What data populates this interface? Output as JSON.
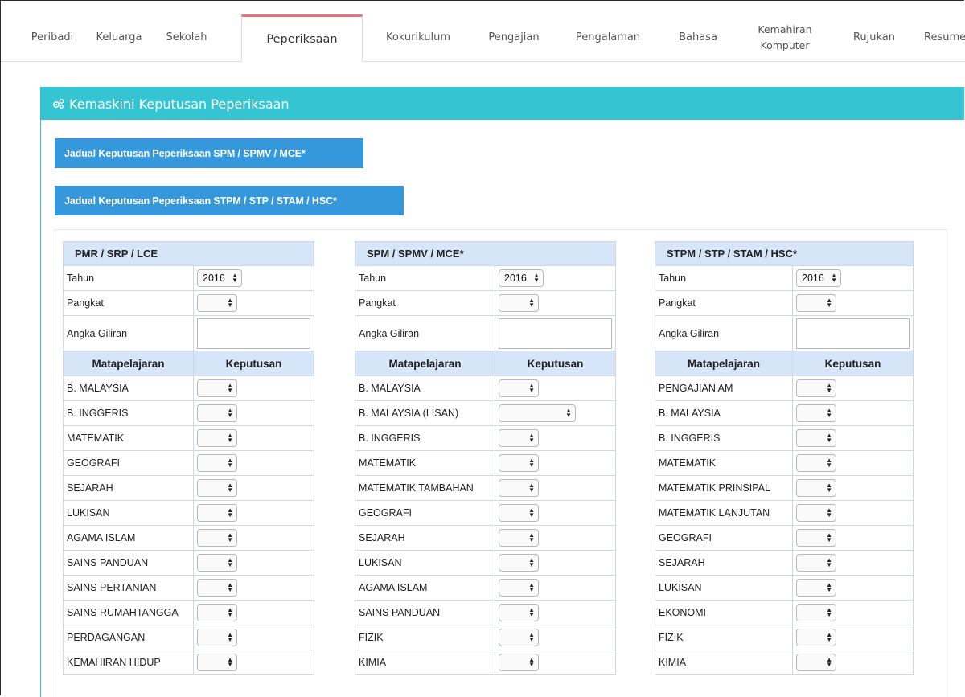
{
  "tabs": [
    {
      "label": "Peribadi"
    },
    {
      "label": "Keluarga"
    },
    {
      "label": "Sekolah"
    },
    {
      "label": "Peperiksaan"
    },
    {
      "label": "Kokurikulum"
    },
    {
      "label": "Pengajian"
    },
    {
      "label": "Pengalaman"
    },
    {
      "label": "Bahasa"
    },
    {
      "label": "Kemahiran Komputer"
    },
    {
      "label": "Rujukan"
    },
    {
      "label": "Resume"
    }
  ],
  "active_tab": "Peperiksaan",
  "panel": {
    "title": "Kemaskini Keputusan Peperiksaan",
    "icon": "cogs-icon",
    "header_color": "#34c4d2"
  },
  "buttons": {
    "spm_schedule": "Jadual Keputusan Peperiksaan SPM / SPMV / MCE*",
    "stpm_schedule": "Jadual Keputusan Peperiksaan STPM / STP / STAM / HSC*",
    "color": "#3598dc"
  },
  "labels": {
    "tahun": "Tahun",
    "pangkat": "Pangkat",
    "angka_giliran": "Angka Giliran",
    "matapelajaran": "Matapelajaran",
    "keputusan": "Keputusan"
  },
  "sections": [
    {
      "title": "PMR / SRP / LCE",
      "tahun": "2016",
      "pangkat": "",
      "angka_giliran": "",
      "subjects": [
        "B. MALAYSIA",
        "B. INGGERIS",
        "MATEMATIK",
        "GEOGRAFI",
        "SEJARAH",
        "LUKISAN",
        "AGAMA ISLAM",
        "SAINS PANDUAN",
        "SAINS PERTANIAN",
        "SAINS RUMAHTANGGA",
        "PERDAGANGAN",
        "KEMAHIRAN HIDUP"
      ]
    },
    {
      "title": "SPM / SPMV / MCE*",
      "tahun": "2016",
      "pangkat": "",
      "angka_giliran": "",
      "subjects": [
        "B. MALAYSIA",
        "B. MALAYSIA (LISAN)",
        "B. INGGERIS",
        "MATEMATIK",
        "MATEMATIK TAMBAHAN",
        "GEOGRAFI",
        "SEJARAH",
        "LUKISAN",
        "AGAMA ISLAM",
        "SAINS PANDUAN",
        "FIZIK",
        "KIMIA"
      ]
    },
    {
      "title": "STPM / STP / STAM / HSC*",
      "tahun": "2016",
      "pangkat": "",
      "angka_giliran": "",
      "subjects": [
        "PENGAJIAN AM",
        "B. MALAYSIA",
        "B. INGGERIS",
        "MATEMATIK",
        "MATEMATIK PRINSIPAL",
        "MATEMATIK LANJUTAN",
        "GEOGRAFI",
        "SEJARAH",
        "LUKISAN",
        "EKONOMI",
        "FIZIK",
        "KIMIA"
      ]
    }
  ]
}
